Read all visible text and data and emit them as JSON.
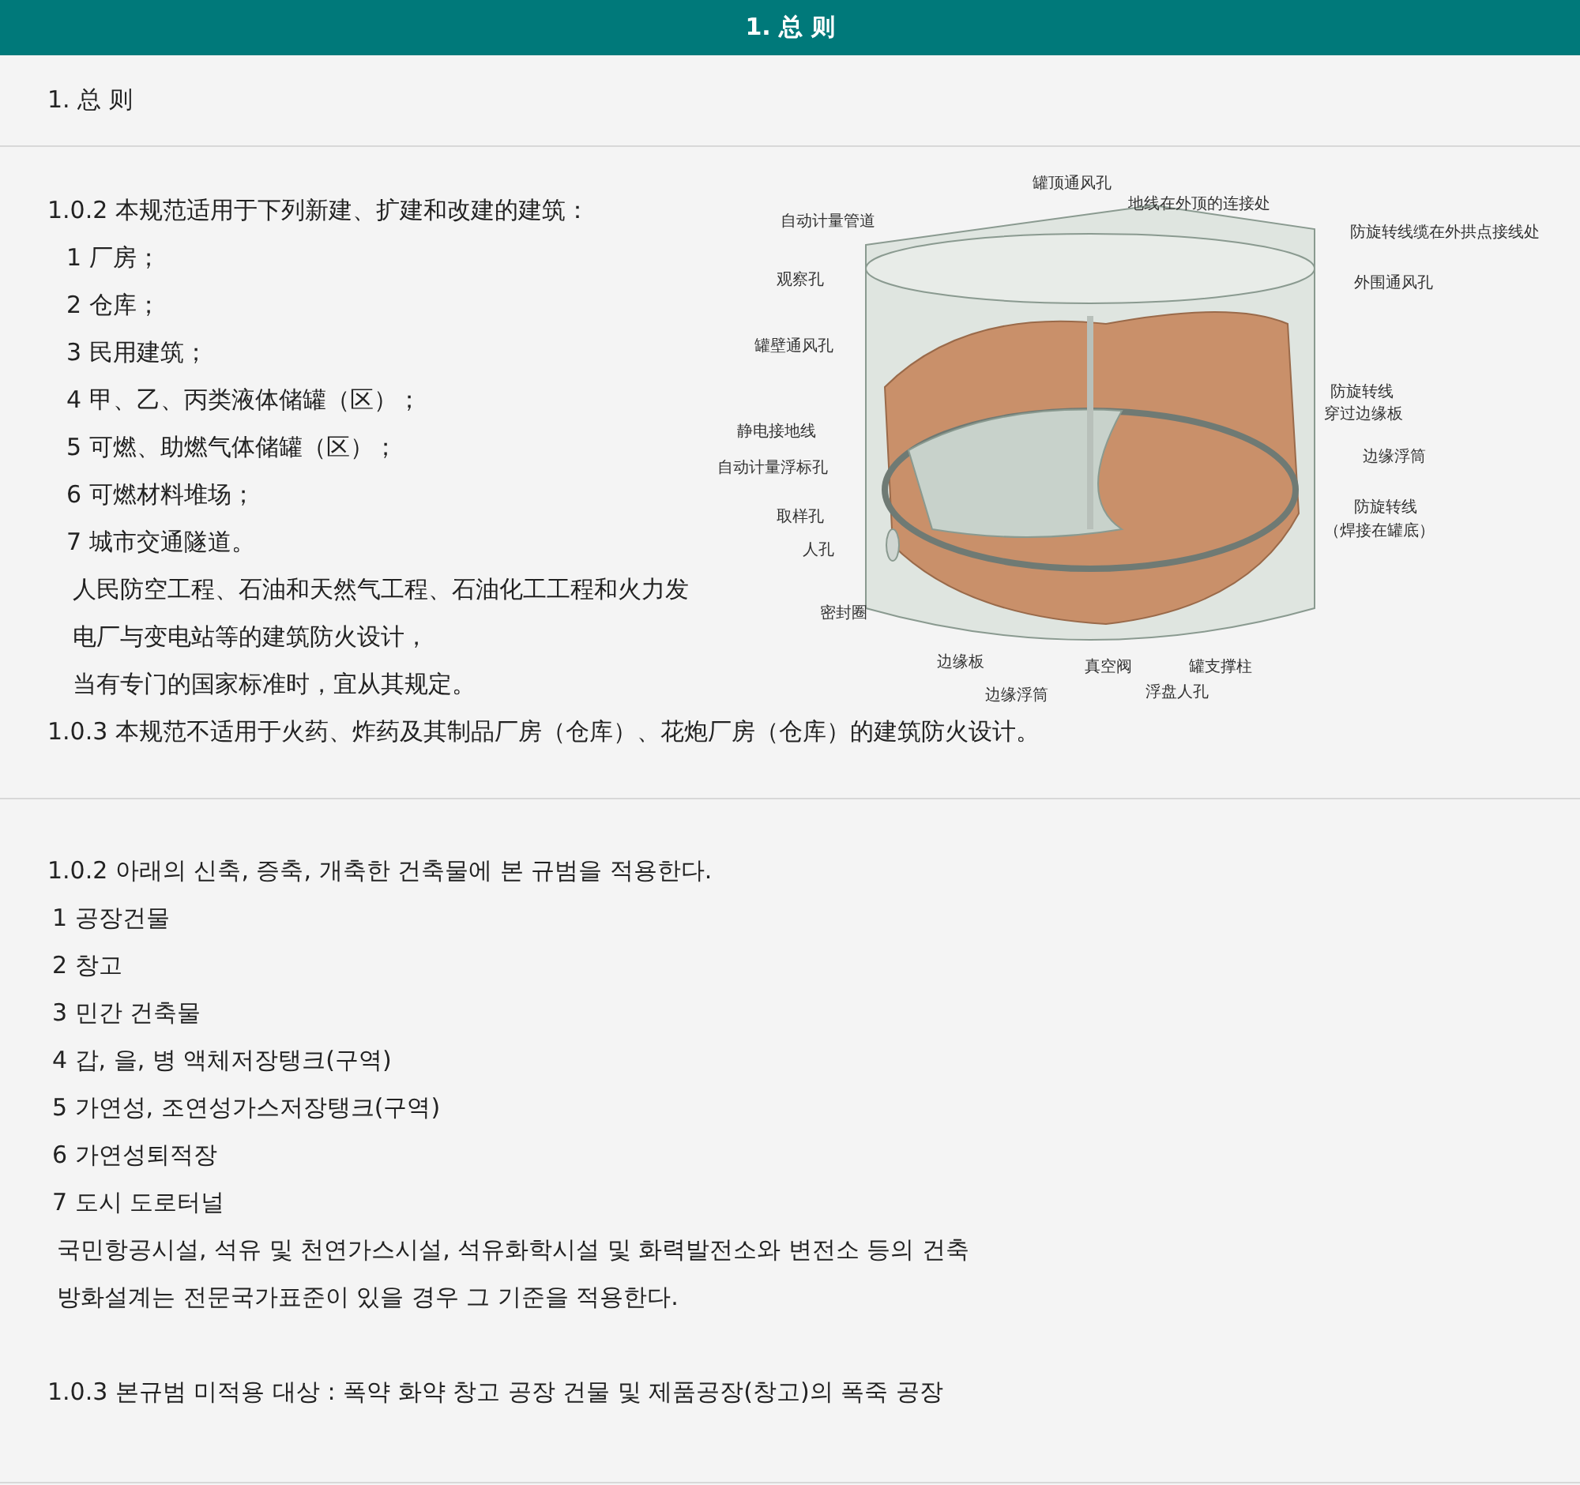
{
  "header": {
    "title": "1. 总 则"
  },
  "section_heading": "1. 总 则",
  "section_zh": {
    "intro": "1.0.2 本规范适用于下列新建、扩建和改建的建筑：",
    "items": [
      "1 厂房；",
      "2 仓库；",
      "3 民用建筑；",
      "4 甲、乙、丙类液体储罐（区）；",
      "5 可燃、助燃气体储罐（区）；",
      "6 可燃材料堆场；",
      "7 城市交通隧道。"
    ],
    "notes": [
      "人民防空工程、石油和天然气工程、石油化工工程和火力发",
      "电厂与变电站等的建筑防火设计，",
      "当有专门的国家标准时，宜从其规定。"
    ],
    "exclusion": "1.0.3 本规范不适用于火药、炸药及其制品厂房（仓库）、花炮厂房（仓库）的建筑防火设计。"
  },
  "diagram": {
    "labels": [
      "罐顶通风孔",
      "地线在外顶的连接处",
      "自动计量管道",
      "防旋转线缆在外拱点接线处",
      "观察孔",
      "外围通风孔",
      "罐壁通风孔",
      "防旋转线",
      "穿过边缘板",
      "静电接地线",
      "边缘浮筒",
      "自动计量浮标孔",
      "取样孔",
      "防旋转线",
      "（焊接在罐底）",
      "人孔",
      "密封圈",
      "边缘板",
      "真空阀",
      "罐支撑柱",
      "边缘浮筒",
      "浮盘人孔"
    ]
  },
  "section_ko": {
    "intro": "1.0.2 아래의 신축, 증축, 개축한 건축물에 본 규범을 적용한다.",
    "items": [
      "1 공장건물",
      "2 창고",
      "3 민간 건축물",
      "4 갑, 을, 병 액체저장탱크(구역)",
      "5 가연성, 조연성가스저장탱크(구역)",
      "6 가연성퇴적장",
      "7 도시 도로터널"
    ],
    "notes": [
      "국민항공시설, 석유 및 천연가스시설, 석유화학시설 및 화력발전소와 변전소 등의 건축",
      "방화설계는 전문국가표준이 있을 경우 그 기준을 적용한다."
    ],
    "exclusion": "1.0.3 본규범 미적용 대상 : 폭약 화약 창고 공장 건물 및 제품공장(창고)의 폭죽 공장"
  }
}
